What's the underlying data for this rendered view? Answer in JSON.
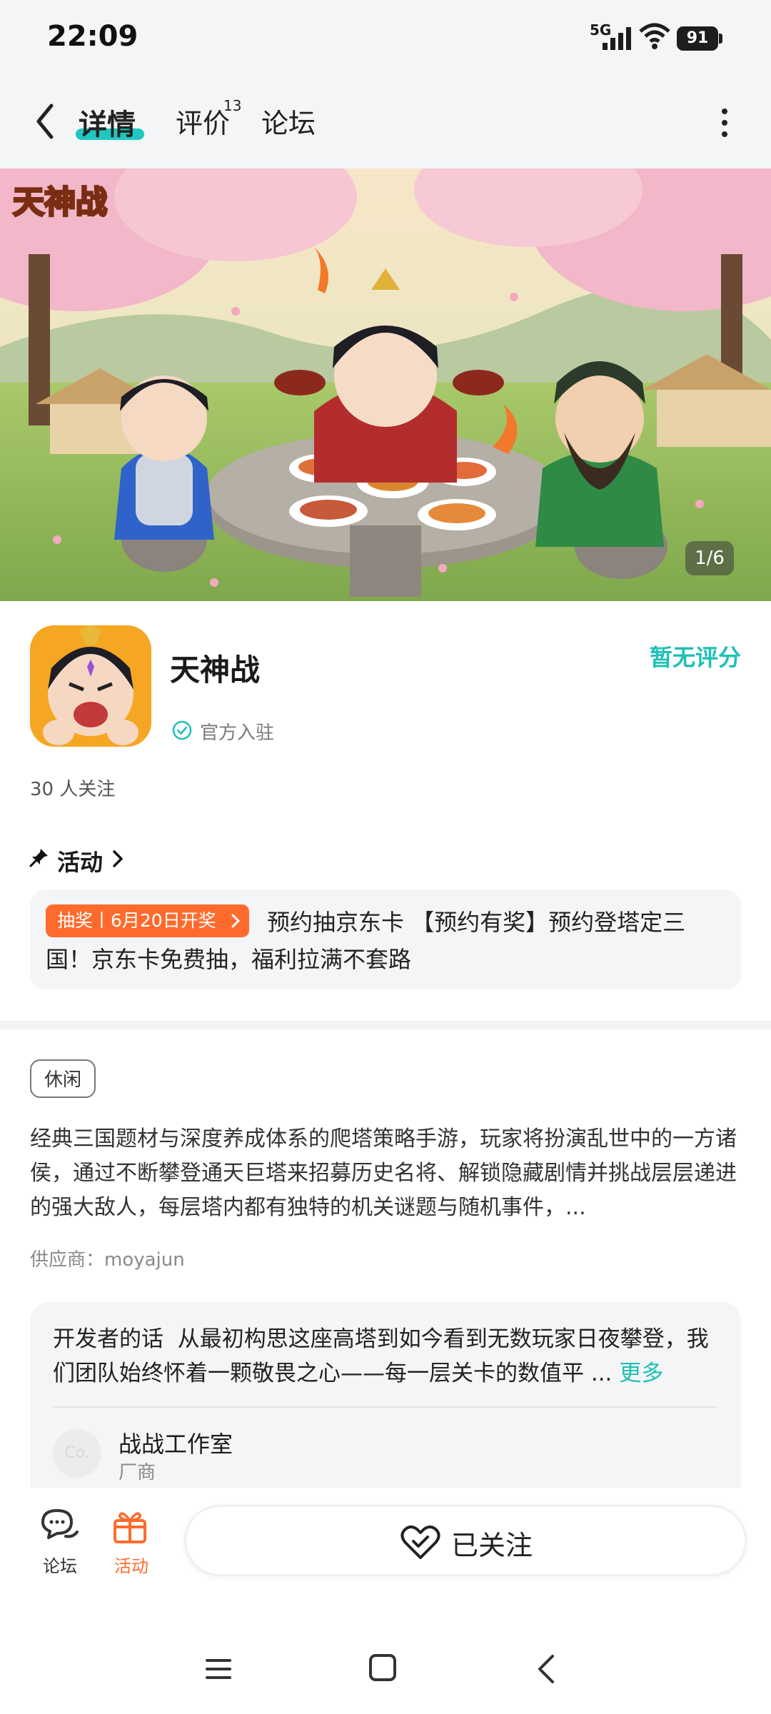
{
  "status_bar": {
    "time": "22:09",
    "network": "5G",
    "battery": "91"
  },
  "nav": {
    "tabs": [
      {
        "label": "详情",
        "active": true
      },
      {
        "label": "评价",
        "count": "13"
      },
      {
        "label": "论坛"
      }
    ]
  },
  "banner": {
    "logo_text": "天神战",
    "counter": "1/6"
  },
  "game": {
    "name": "天神战",
    "badge": "官方入驻",
    "rating": "暂无评分",
    "followers": "30 人关注"
  },
  "activity": {
    "title": "活动",
    "tag": "抽奖丨6月20日开奖",
    "text": "预约抽京东卡 【预约有奖】预约登塔定三国！京东卡免费抽，福利拉满不套路"
  },
  "details": {
    "genre_tag": "休闲",
    "description": "经典三国题材与深度养成体系的爬塔策略手游，玩家将扮演乱世中的一方诸侯，通过不断攀登通天巨塔来招募历史名将、解锁隐藏剧情并挑战层层递进的强大敌人，每层塔内都有独特的机关谜题与随机事件，...",
    "supplier": "供应商：moyajun"
  },
  "developer": {
    "label": "开发者的话",
    "words": "从最初构思这座高塔到如今看到无数玩家日夜攀登，我们团队始终怀着一颗敬畏之心——每一层关卡的数值平 ...",
    "more": "更多",
    "avatar_text": "Co.",
    "studio": "战战工作室",
    "role": "厂商"
  },
  "bottom_bar": {
    "forum_label": "论坛",
    "activity_label": "活动",
    "follow_label": "已关注"
  },
  "colors": {
    "accent": "#1ec0b6",
    "orange": "#ff6b2c",
    "tab_underline": "#1ec8c0"
  }
}
